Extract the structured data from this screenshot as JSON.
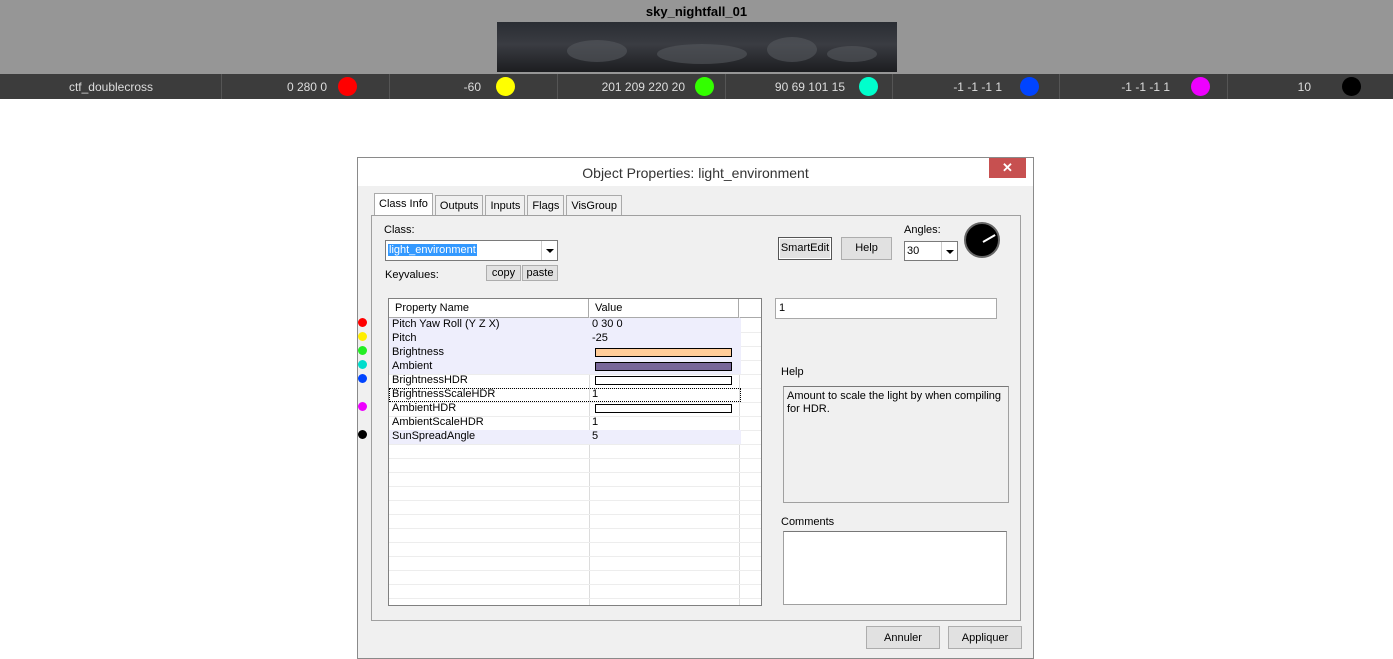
{
  "sky": {
    "title": "sky_nightfall_01"
  },
  "strip": [
    {
      "text": "ctf_doublecross",
      "color": null
    },
    {
      "text": "0 280 0",
      "color": "#ff0000"
    },
    {
      "text": "-60",
      "color": "#ffff00"
    },
    {
      "text": "201 209 220 20",
      "color": "#33ff00"
    },
    {
      "text": "90 69 101 15",
      "color": "#00ffcc"
    },
    {
      "text": "-1 -1 -1 1",
      "color": "#0044ff"
    },
    {
      "text": "-1 -1 -1 1",
      "color": "#ee00ff"
    },
    {
      "text": "10",
      "color": "#000000"
    }
  ],
  "dialog": {
    "title": "Object Properties: light_environment",
    "close": "✕",
    "tabs": [
      "Class Info",
      "Outputs",
      "Inputs",
      "Flags",
      "VisGroup"
    ],
    "class_label": "Class:",
    "class_value": "light_environment",
    "keyvalues_label": "Keyvalues:",
    "copy": "copy",
    "paste": "paste",
    "smartedit": "SmartEdit",
    "help_button": "Help",
    "angles_label": "Angles:",
    "angles_value": "30",
    "grid_headers": [
      "Property Name",
      "Value"
    ],
    "rows": [
      {
        "name": "Pitch Yaw Roll (Y Z X)",
        "value": "0 30 0",
        "dot": "#ff0000",
        "swatch": null
      },
      {
        "name": "Pitch",
        "value": "-25",
        "dot": "#ffee00",
        "swatch": null
      },
      {
        "name": "Brightness",
        "value": "",
        "dot": "#22ee22",
        "swatch": "#ffcc99"
      },
      {
        "name": "Ambient",
        "value": "",
        "dot": "#00ddcc",
        "swatch": "#776699"
      },
      {
        "name": "BrightnessHDR",
        "value": "",
        "dot": "#0044ff",
        "swatch": "#ffffff"
      },
      {
        "name": "BrightnessScaleHDR",
        "value": "1",
        "dot": null,
        "swatch": null
      },
      {
        "name": "AmbientHDR",
        "value": "",
        "dot": "#ee00ff",
        "swatch": "#ffffff"
      },
      {
        "name": "AmbientScaleHDR",
        "value": "1",
        "dot": null,
        "swatch": null
      },
      {
        "name": "SunSpreadAngle",
        "value": "5",
        "dot": "#000000",
        "swatch": null
      }
    ],
    "value_input": "1",
    "help_label": "Help",
    "help_text": "Amount to scale the light by when compiling for HDR.",
    "comments_label": "Comments",
    "cancel": "Annuler",
    "apply": "Appliquer"
  }
}
